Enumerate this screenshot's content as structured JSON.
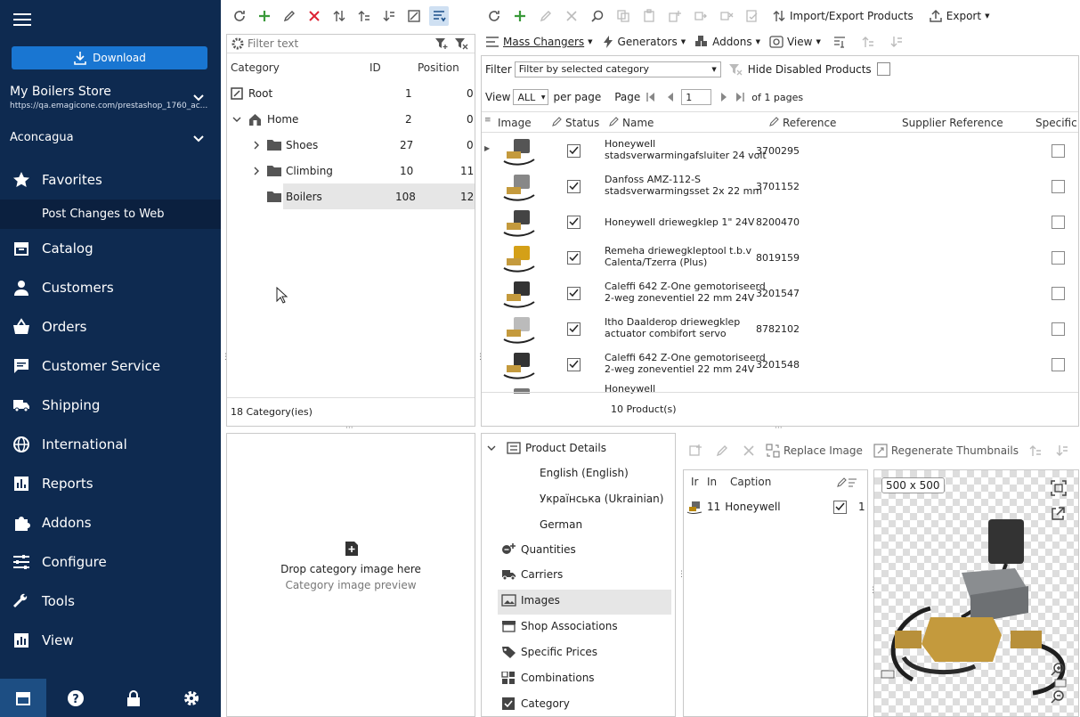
{
  "sidebar": {
    "download_label": "Download",
    "store_name": "My Boilers Store",
    "store_url": "https://qa.emagicone.com/prestashop_1760_ac...",
    "shop_select": "Aconcagua",
    "items": [
      {
        "label": "Favorites",
        "icon": "star-icon"
      },
      {
        "label": "Catalog",
        "icon": "box-icon"
      },
      {
        "label": "Customers",
        "icon": "person-icon"
      },
      {
        "label": "Orders",
        "icon": "basket-icon"
      },
      {
        "label": "Customer Service",
        "icon": "chat-icon"
      },
      {
        "label": "Shipping",
        "icon": "truck-icon"
      },
      {
        "label": "International",
        "icon": "globe-icon"
      },
      {
        "label": "Reports",
        "icon": "chart-icon"
      },
      {
        "label": "Addons",
        "icon": "puzzle-icon"
      },
      {
        "label": "Configure",
        "icon": "sliders-icon"
      },
      {
        "label": "Tools",
        "icon": "wrench-icon"
      },
      {
        "label": "View",
        "icon": "barchart-icon"
      }
    ],
    "sub_item": "Post Changes to Web"
  },
  "categories": {
    "filter_placeholder": "Filter text",
    "headers": {
      "category": "Category",
      "id": "ID",
      "position": "Position"
    },
    "rows": [
      {
        "name": "Root",
        "id": "1",
        "position": "0"
      },
      {
        "name": "Home",
        "id": "2",
        "position": "0"
      },
      {
        "name": "Shoes",
        "id": "27",
        "position": "0"
      },
      {
        "name": "Climbing",
        "id": "10",
        "position": "11"
      },
      {
        "name": "Boilers",
        "id": "108",
        "position": "12"
      }
    ],
    "count": "18 Category(ies)",
    "drop_title": "Drop category image here",
    "drop_sub": "Category image preview"
  },
  "products": {
    "toolbar": {
      "import_export": "Import/Export Products",
      "export": "Export",
      "mass_changers": "Mass Changers",
      "generators": "Generators",
      "addons": "Addons",
      "view": "View"
    },
    "filter_label": "Filter",
    "filter_value": "Filter by selected category",
    "hide_disabled": "Hide Disabled Products",
    "view_label": "View",
    "view_value": "ALL",
    "per_page": "per page",
    "page_label": "Page",
    "page_value": "1",
    "of_pages": "of 1 pages",
    "headers": {
      "image": "Image",
      "status": "Status",
      "name": "Name",
      "reference": "Reference",
      "supplier_reference": "Supplier Reference",
      "specific": "Specific"
    },
    "rows": [
      {
        "name1": "Honeywell",
        "name2": "stadsverwarmingafsluiter 24 volt",
        "reference": "3700295"
      },
      {
        "name1": "Danfoss AMZ-112-S",
        "name2": "stadsverwarmingsset 2x 22 mm",
        "reference": "3701152"
      },
      {
        "name1": "Honeywell driewegklep 1\" 24V",
        "name2": "",
        "reference": "8200470"
      },
      {
        "name1": "Remeha driewegkleptool t.b.v",
        "name2": "Calenta/Tzerra (Plus)",
        "reference": "8019159"
      },
      {
        "name1": "Caleffi 642 Z-One gemotoriseerd",
        "name2": "2-weg zoneventiel 22 mm 24V",
        "reference": "3201547"
      },
      {
        "name1": "Itho Daalderop driewegklep",
        "name2": "actuator combifort servo",
        "reference": "8782102"
      },
      {
        "name1": "Caleffi 642 Z-One gemotoriseerd",
        "name2": "2-weg zoneventiel 22 mm 24V",
        "reference": "3201548"
      },
      {
        "name1": "Honeywell",
        "name2": "",
        "reference": ""
      }
    ],
    "count": "10 Product(s)"
  },
  "details": {
    "root": "Product Details",
    "items": [
      "English (English)",
      "Українська (Ukrainian)",
      "German",
      "Quantities",
      "Carriers",
      "Images",
      "Shop Associations",
      "Specific Prices",
      "Combinations",
      "Category"
    ]
  },
  "images": {
    "replace_label": "Replace Image",
    "regen_label": "Regenerate Thumbnails",
    "headers": {
      "ir": "Ir",
      "in": "In",
      "caption": "Caption"
    },
    "row": {
      "id": "11",
      "caption": "Honeywell",
      "position": "1"
    },
    "preview_size": "500 x 500"
  }
}
